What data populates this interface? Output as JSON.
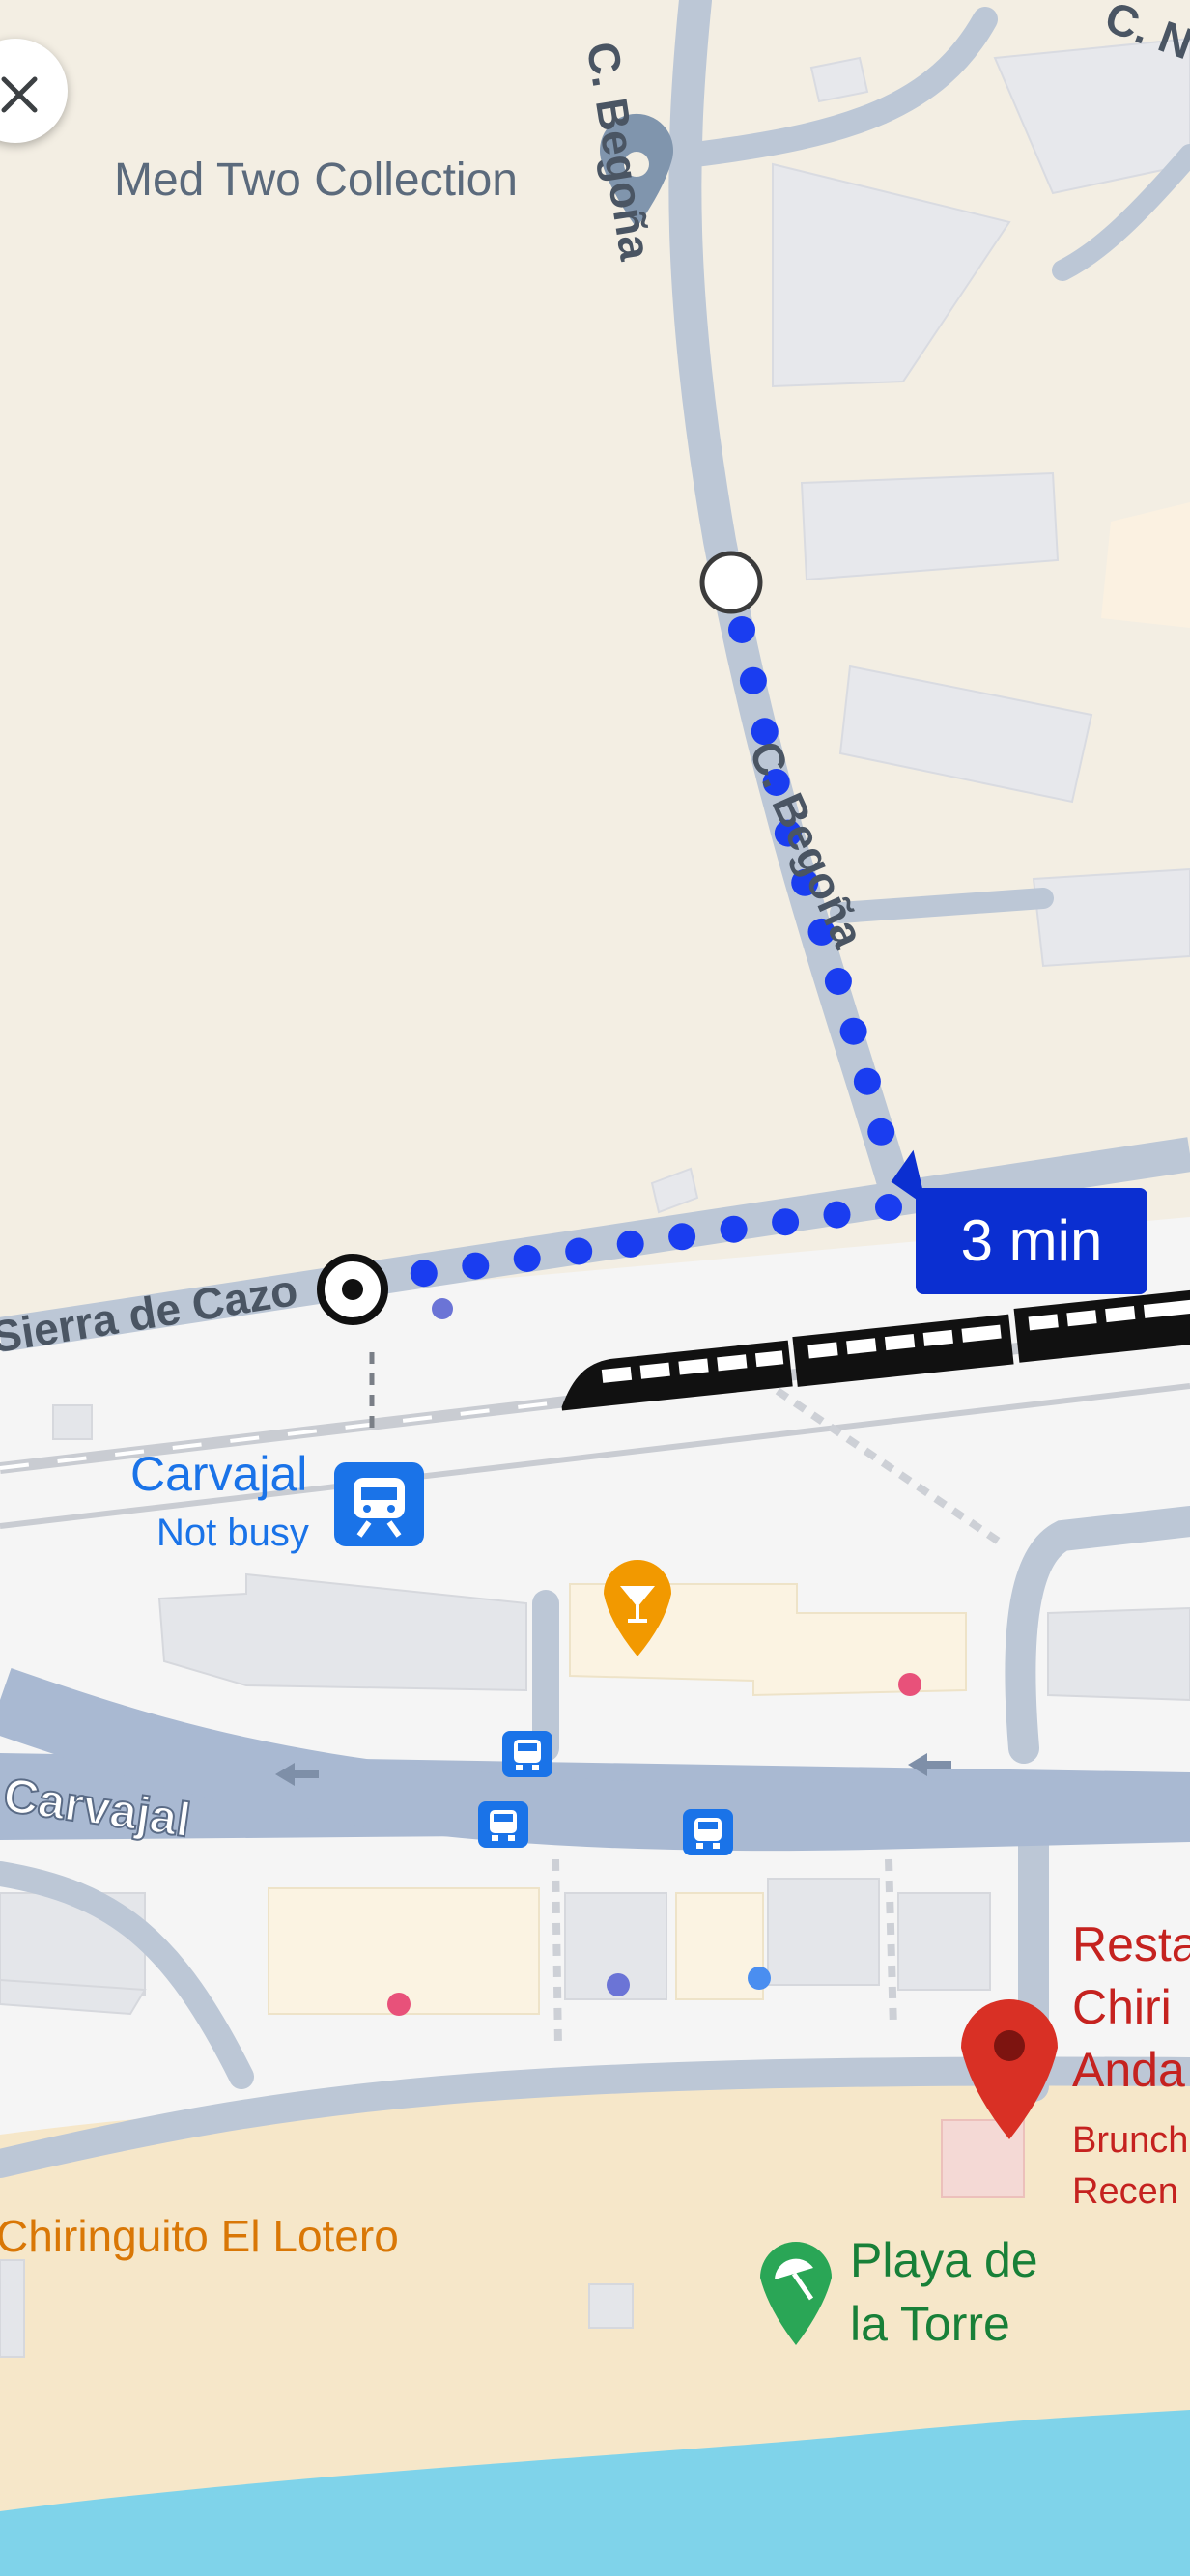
{
  "map": {
    "pois": {
      "hotel": {
        "label": "Med Two Collection",
        "icon": "place-pin-icon"
      },
      "station": {
        "name": "Carvajal",
        "status": "Not busy",
        "icon": "train-station-icon"
      },
      "restaurant": {
        "name": "Restaurante Chiringuito Andalucia",
        "line1": "Resta",
        "line2": "Chiri",
        "line3": "Anda",
        "category_fragment": "Brunch",
        "status_fragment": "Recen",
        "icon": "restaurant-pin-icon"
      },
      "beach_bar": {
        "label": "Chiringuito El Lotero"
      },
      "beach": {
        "line1": "Playa de",
        "line2": "la Torre",
        "icon": "beach-umbrella-icon"
      },
      "bar": {
        "icon": "cocktail-icon"
      }
    },
    "roads": {
      "begona_top": "C. Begoña",
      "begona_mid": "C. Begoña",
      "sierra": "Sierra de Cazorla",
      "sierra_visible": "Sierra de Cazo",
      "carvajal": "Carvajal",
      "corner": "C. N"
    },
    "route": {
      "duration": "3 min",
      "mode": "walking",
      "color": "#1a3df0"
    },
    "colors": {
      "land": "#f3eee3",
      "urban": "#f5f5f5",
      "road": "#b6c4d6",
      "main_road": "#a8b9d2",
      "sand": "#f5e6c8",
      "sea": "#7ed3ea",
      "poi_blue": "#1a73e8",
      "poi_orange": "#f29900",
      "poi_red": "#d93025",
      "poi_green": "#2aa656"
    }
  },
  "controls": {
    "back_icon": "close-icon"
  }
}
